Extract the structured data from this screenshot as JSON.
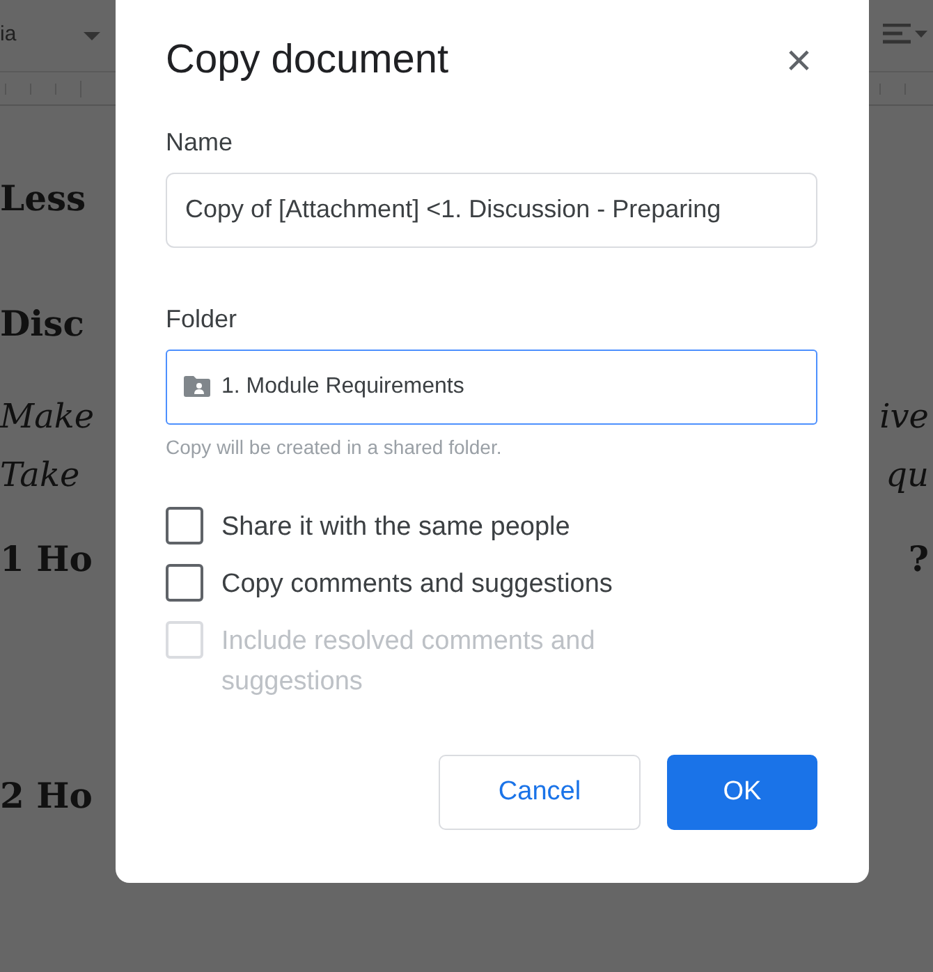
{
  "background_document": {
    "toolbar": {
      "font_name": "ia"
    },
    "lines": [
      {
        "kind": "heading",
        "left": "Less"
      },
      {
        "kind": "heading",
        "left": "Disc"
      },
      {
        "kind": "italic",
        "left": "Make",
        "right": "ive"
      },
      {
        "kind": "italic",
        "left": "Take",
        "right": "qu"
      },
      {
        "kind": "subheading",
        "left": "1 Ho",
        "right": "?"
      },
      {
        "kind": "gap"
      },
      {
        "kind": "subheading",
        "left": "2 Ho"
      }
    ]
  },
  "dialog": {
    "title": "Copy document",
    "close": "×",
    "name_label": "Name",
    "name_value": "Copy of [Attachment] <1. Discussion - Preparing",
    "folder_label": "Folder",
    "folder_value": "1. Module Requirements",
    "folder_hint": "Copy will be created in a shared folder.",
    "options": [
      {
        "label": "Share it with the same people",
        "checked": false,
        "disabled": false
      },
      {
        "label": "Copy comments and suggestions",
        "checked": false,
        "disabled": false
      },
      {
        "label": "Include resolved comments and suggestions",
        "checked": false,
        "disabled": true
      }
    ],
    "buttons": [
      {
        "label": "Cancel",
        "kind": "secondary"
      },
      {
        "label": "OK",
        "kind": "primary"
      }
    ]
  }
}
